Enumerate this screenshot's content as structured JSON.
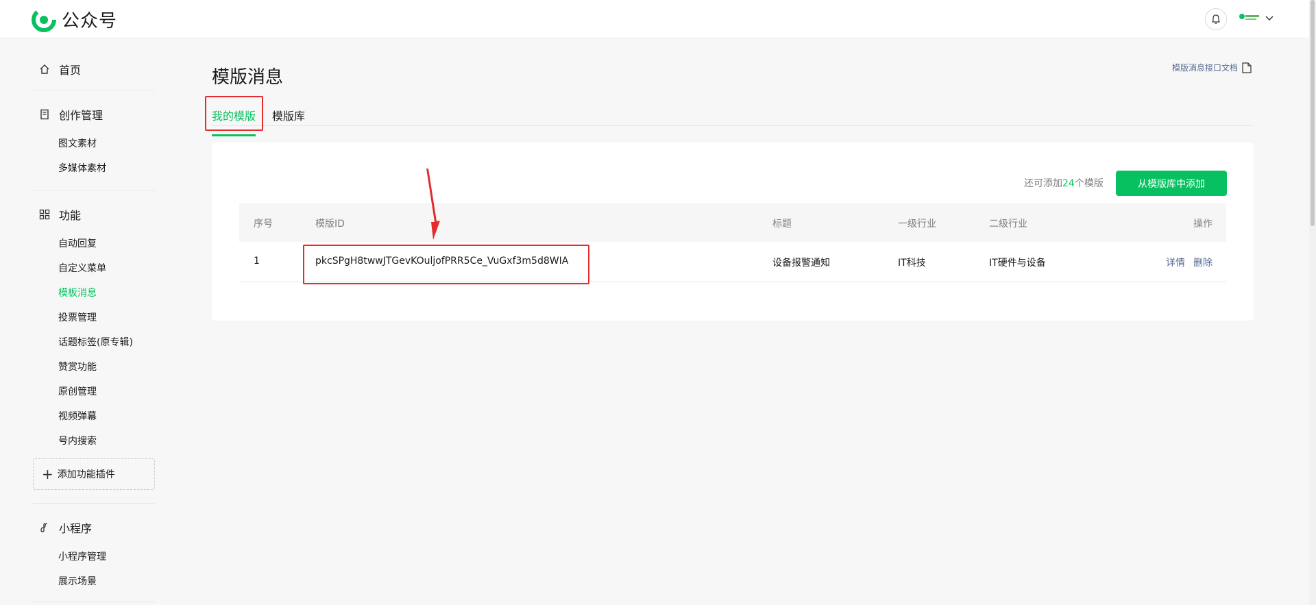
{
  "header": {
    "brand": "公众号",
    "brand_color": "#07c160"
  },
  "sidebar": {
    "home": "首页",
    "create_title": "创作管理",
    "create_items": [
      "图文素材",
      "多媒体素材"
    ],
    "func_title": "功能",
    "func_items": [
      "自动回复",
      "自定义菜单",
      "模板消息",
      "投票管理",
      "话题标签(原专辑)",
      "赞赏功能",
      "原创管理",
      "视频弹幕",
      "号内搜索"
    ],
    "active_item": "模板消息",
    "add_plugin": "添加功能插件",
    "mini_title": "小程序",
    "mini_items": [
      "小程序管理",
      "展示场景"
    ]
  },
  "main": {
    "title": "模版消息",
    "doc_link": "模版消息接口文档",
    "tabs": [
      "我的模版",
      "模版库"
    ],
    "remain_prefix": "还可添加",
    "remain_count": "24",
    "remain_suffix": "个模版",
    "add_button": "从模版库中添加",
    "table": {
      "headers": [
        "序号",
        "模版ID",
        "标题",
        "一级行业",
        "二级行业",
        "操作"
      ],
      "rows": [
        {
          "index": "1",
          "template_id": "pkcSPgH8twwJTGevKOuljofPRR5Ce_VuGxf3m5d8WIA",
          "title": "设备报警通知",
          "industry1": "IT科技",
          "industry2": "IT硬件与设备",
          "actions": [
            "详情",
            "删除"
          ]
        }
      ]
    }
  },
  "colors": {
    "accent": "#07c160",
    "link": "#576b95",
    "annotation": "#e52b2b"
  }
}
